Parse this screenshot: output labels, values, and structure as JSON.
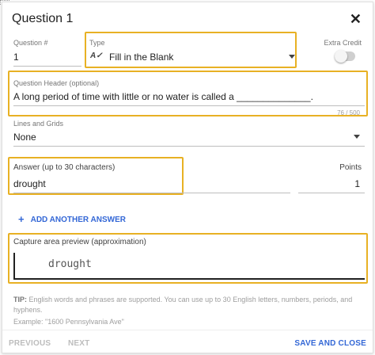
{
  "dialog": {
    "title": "Question 1"
  },
  "question_number": {
    "label": "Question #",
    "value": "1"
  },
  "type": {
    "label": "Type",
    "icon": "fill-in-the-blank-icon",
    "icon_glyph": "A✓",
    "selected": "Fill in the Blank"
  },
  "extra_credit": {
    "label": "Extra Credit",
    "enabled": false
  },
  "header": {
    "label": "Question Header (optional)",
    "value": "A long period of time with little or no water is called a ______________.",
    "counter": "76 / 500"
  },
  "lines_grids": {
    "label": "Lines and Grids",
    "selected": "None"
  },
  "answer": {
    "label": "Answer (up to 30 characters)",
    "value": "drought"
  },
  "points": {
    "label": "Points",
    "value": "1"
  },
  "add_answer": {
    "label": "ADD ANOTHER ANSWER"
  },
  "capture": {
    "label": "Capture area preview (approximation)",
    "preview": "drought"
  },
  "tip": {
    "prefix": "TIP:",
    "text": "English words and phrases are supported. You can use up to 30 English letters, numbers, periods, and hyphens.",
    "example": "Example: \"1600 Pennsylvania Ave\""
  },
  "footer": {
    "previous": "PREVIOUS",
    "next": "NEXT",
    "save_close": "SAVE AND CLOSE"
  },
  "colors": {
    "highlight": "#e8b124",
    "accent": "#3367d6",
    "disabled": "#bdbdbd"
  }
}
